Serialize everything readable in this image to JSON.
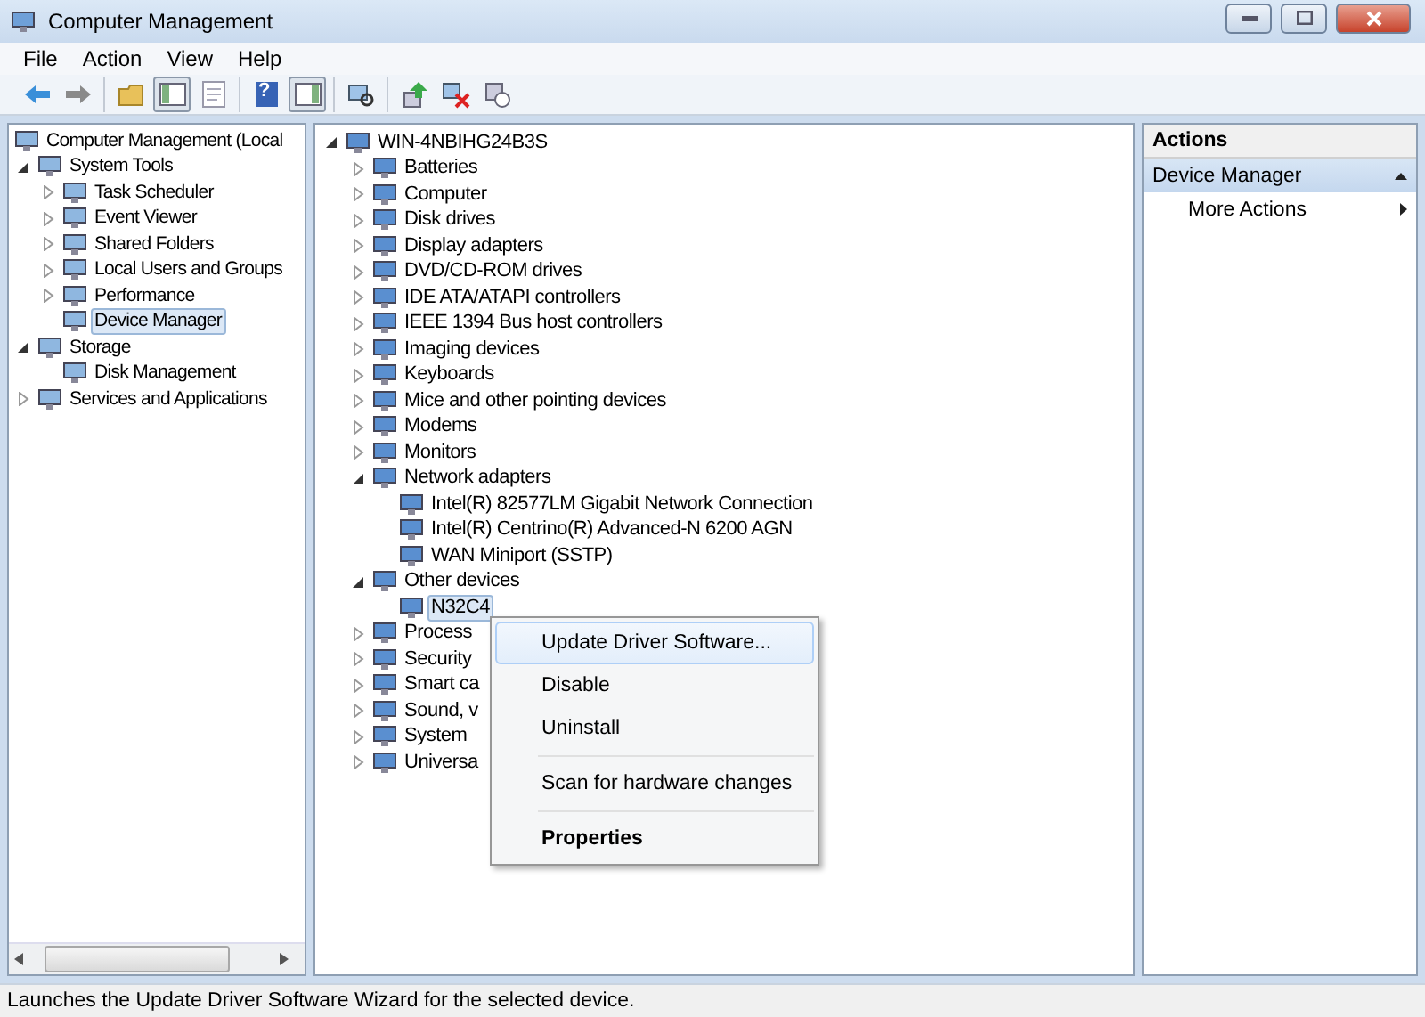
{
  "window": {
    "title": "Computer Management"
  },
  "menu": [
    "File",
    "Action",
    "View",
    "Help"
  ],
  "toolbar": {
    "groups": [
      [
        {
          "kind": "back",
          "pressed": false
        },
        {
          "kind": "forward",
          "pressed": false
        }
      ],
      [
        {
          "kind": "up-folder",
          "pressed": false
        },
        {
          "kind": "tree-pane",
          "pressed": true
        },
        {
          "kind": "export",
          "pressed": false
        }
      ],
      [
        {
          "kind": "help",
          "pressed": false,
          "glyph": "?"
        },
        {
          "kind": "action-pane",
          "pressed": true
        }
      ],
      [
        {
          "kind": "scan",
          "pressed": false
        }
      ],
      [
        {
          "kind": "update",
          "pressed": false
        },
        {
          "kind": "uninstall",
          "pressed": false
        },
        {
          "kind": "disable",
          "pressed": false
        }
      ]
    ]
  },
  "left_tree": {
    "items": [
      {
        "label": "Computer Management (Local",
        "selected": false,
        "children": [
          {
            "label": "System Tools",
            "expanded": true,
            "selected": false,
            "children": [
              {
                "label": "Task Scheduler",
                "expanded": false,
                "selected": false
              },
              {
                "label": "Event Viewer",
                "expanded": false,
                "selected": false
              },
              {
                "label": "Shared Folders",
                "expanded": false,
                "selected": false
              },
              {
                "label": "Local Users and Groups",
                "expanded": false,
                "selected": false
              },
              {
                "label": "Performance",
                "expanded": false,
                "selected": false
              },
              {
                "label": "Device Manager",
                "selected": true
              }
            ]
          },
          {
            "label": "Storage",
            "expanded": true,
            "selected": false,
            "children": [
              {
                "label": "Disk Management",
                "selected": false
              }
            ]
          },
          {
            "label": "Services and Applications",
            "expanded": false,
            "selected": false
          }
        ]
      }
    ]
  },
  "device_tree": {
    "items": [
      {
        "label": "WIN-4NBIHG24B3S",
        "expanded": true,
        "selected": false,
        "children": [
          {
            "label": "Batteries",
            "expanded": false,
            "selected": false
          },
          {
            "label": "Computer",
            "expanded": false,
            "selected": false
          },
          {
            "label": "Disk drives",
            "expanded": false,
            "selected": false
          },
          {
            "label": "Display adapters",
            "expanded": false,
            "selected": false
          },
          {
            "label": "DVD/CD-ROM drives",
            "expanded": false,
            "selected": false
          },
          {
            "label": "IDE ATA/ATAPI controllers",
            "expanded": false,
            "selected": false
          },
          {
            "label": "IEEE 1394 Bus host controllers",
            "expanded": false,
            "selected": false
          },
          {
            "label": "Imaging devices",
            "expanded": false,
            "selected": false
          },
          {
            "label": "Keyboards",
            "expanded": false,
            "selected": false
          },
          {
            "label": "Mice and other pointing devices",
            "expanded": false,
            "selected": false
          },
          {
            "label": "Modems",
            "expanded": false,
            "selected": false
          },
          {
            "label": "Monitors",
            "expanded": false,
            "selected": false
          },
          {
            "label": "Network adapters",
            "expanded": true,
            "selected": false,
            "children": [
              {
                "label": "Intel(R) 82577LM Gigabit Network Connection",
                "selected": false
              },
              {
                "label": "Intel(R) Centrino(R) Advanced-N 6200 AGN",
                "selected": false
              },
              {
                "label": "WAN Miniport (SSTP)",
                "selected": false
              }
            ]
          },
          {
            "label": "Other devices",
            "expanded": true,
            "selected": false,
            "children": [
              {
                "label": "N32C4",
                "selected": true
              }
            ]
          },
          {
            "label": "Process",
            "expanded": false,
            "selected": false
          },
          {
            "label": "Security",
            "expanded": false,
            "selected": false
          },
          {
            "label": "Smart ca",
            "expanded": false,
            "selected": false
          },
          {
            "label": "Sound, v",
            "expanded": false,
            "selected": false
          },
          {
            "label": "System",
            "expanded": false,
            "selected": false
          },
          {
            "label": "Universa",
            "expanded": false,
            "selected": false
          }
        ]
      }
    ]
  },
  "context_menu": [
    {
      "kind": "item",
      "label": "Update Driver Software...",
      "selected": true
    },
    {
      "kind": "item",
      "label": "Disable",
      "selected": false
    },
    {
      "kind": "item",
      "label": "Uninstall",
      "selected": false
    },
    {
      "kind": "separator"
    },
    {
      "kind": "item",
      "label": "Scan for hardware changes",
      "selected": false
    },
    {
      "kind": "separator"
    },
    {
      "kind": "default",
      "label": "Properties",
      "selected": false
    }
  ],
  "actions": {
    "title": "Actions",
    "section": "Device Manager",
    "items": [
      "More Actions"
    ]
  },
  "status_bar": "Launches the Update Driver Software Wizard for the selected device."
}
